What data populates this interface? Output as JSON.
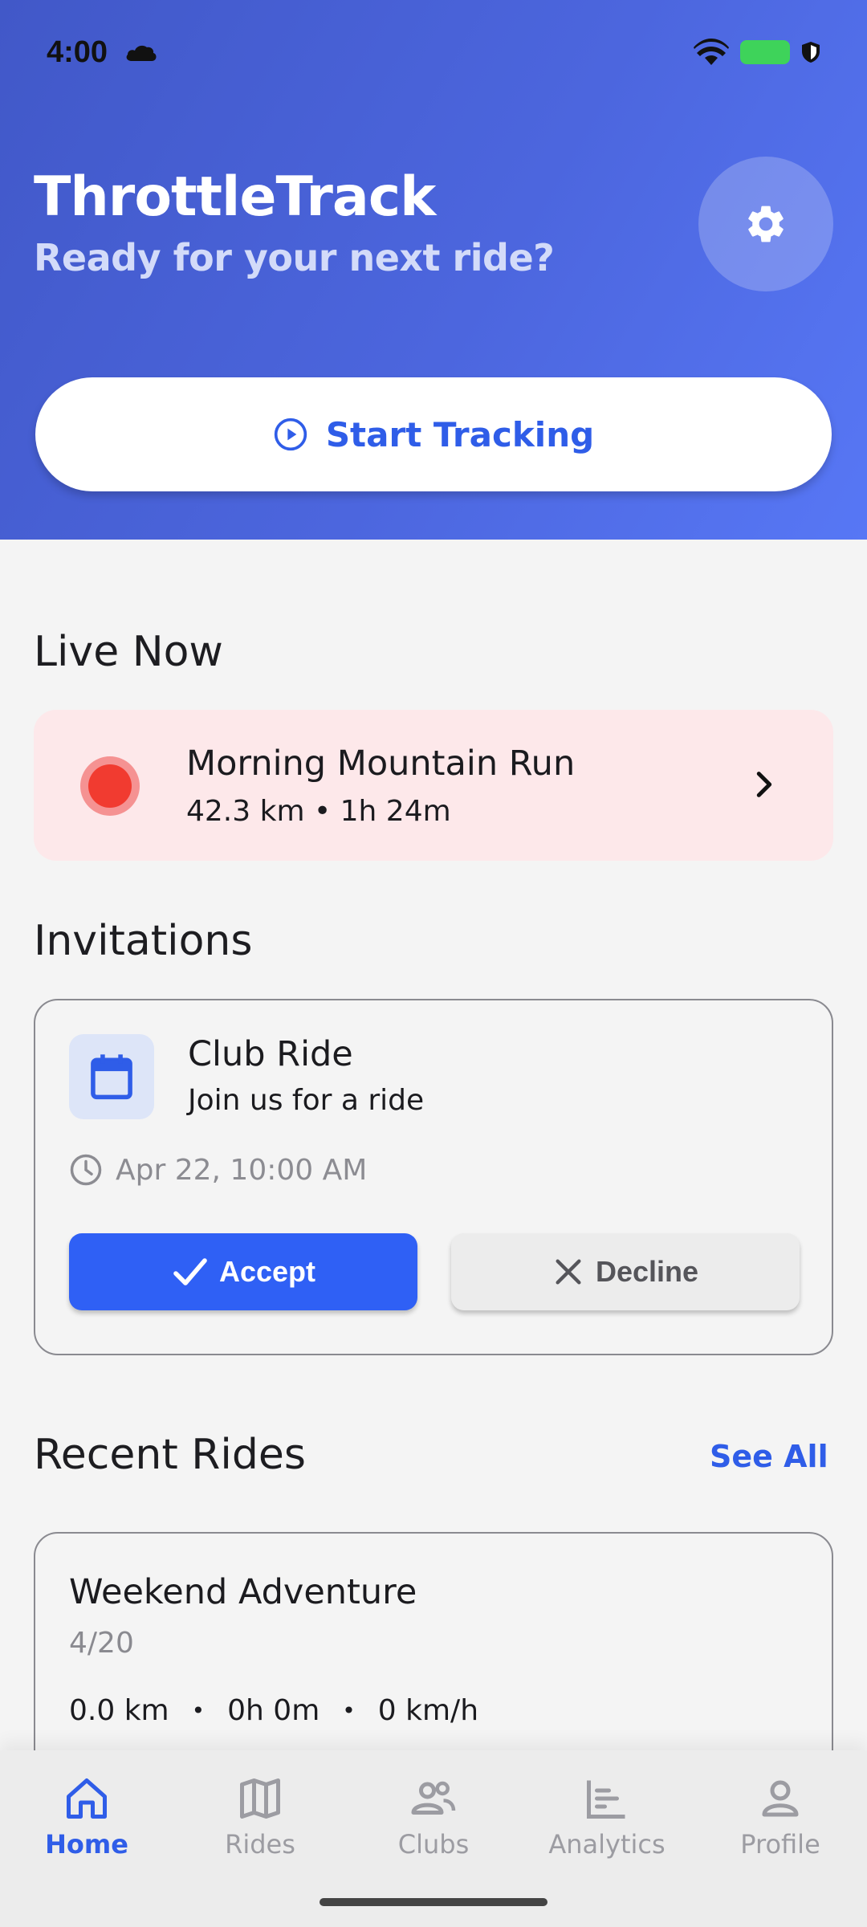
{
  "status_bar": {
    "time": "4:00"
  },
  "header": {
    "title": "ThrottleTrack",
    "subtitle": "Ready for your next ride?",
    "start_label": "Start Tracking"
  },
  "live": {
    "section_title": "Live Now",
    "ride_name": "Morning Mountain Run",
    "stats": "42.3 km • 1h 24m"
  },
  "invitations": {
    "section_title": "Invitations",
    "title": "Club Ride",
    "description": "Join us for a ride",
    "time": "Apr 22, 10:00 AM",
    "accept_label": "Accept",
    "decline_label": "Decline"
  },
  "recent": {
    "section_title": "Recent Rides",
    "see_all": "See All",
    "rides": [
      {
        "title": "Weekend Adventure",
        "date": "4/20",
        "distance": "0.0 km",
        "duration": "0h 0m",
        "speed": "0 km/h"
      }
    ]
  },
  "nav": {
    "items": [
      {
        "label": "Home",
        "icon": "home-icon",
        "active": true
      },
      {
        "label": "Rides",
        "icon": "map-icon",
        "active": false
      },
      {
        "label": "Clubs",
        "icon": "group-icon",
        "active": false
      },
      {
        "label": "Analytics",
        "icon": "analytics-icon",
        "active": false
      },
      {
        "label": "Profile",
        "icon": "person-icon",
        "active": false
      }
    ]
  },
  "colors": {
    "accent": "#2f5de8",
    "live_bg": "#fde8ea",
    "live_dot": "#f13b30"
  }
}
